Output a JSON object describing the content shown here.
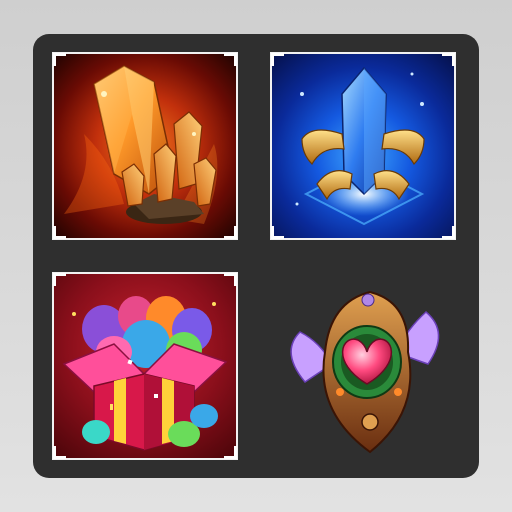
{
  "inventory": {
    "items": [
      {
        "name": "amber-crystal",
        "icon": "orange-crystal-cluster-icon",
        "frame": true
      },
      {
        "name": "sapphire-crystal",
        "icon": "blue-crystal-winged-pedestal-icon",
        "frame": true
      },
      {
        "name": "egg-gift-box",
        "icon": "gift-box-with-eggs-icon",
        "frame": true
      },
      {
        "name": "winged-heart-amulet",
        "icon": "winged-heart-amulet-icon",
        "frame": false
      }
    ]
  },
  "colors": {
    "panel": "#2f2f2f",
    "frame": "#f2f2f2",
    "fire_bg": "#c2300c",
    "blue_bg": "#1459e0",
    "red_bg": "#8a0f1b"
  }
}
